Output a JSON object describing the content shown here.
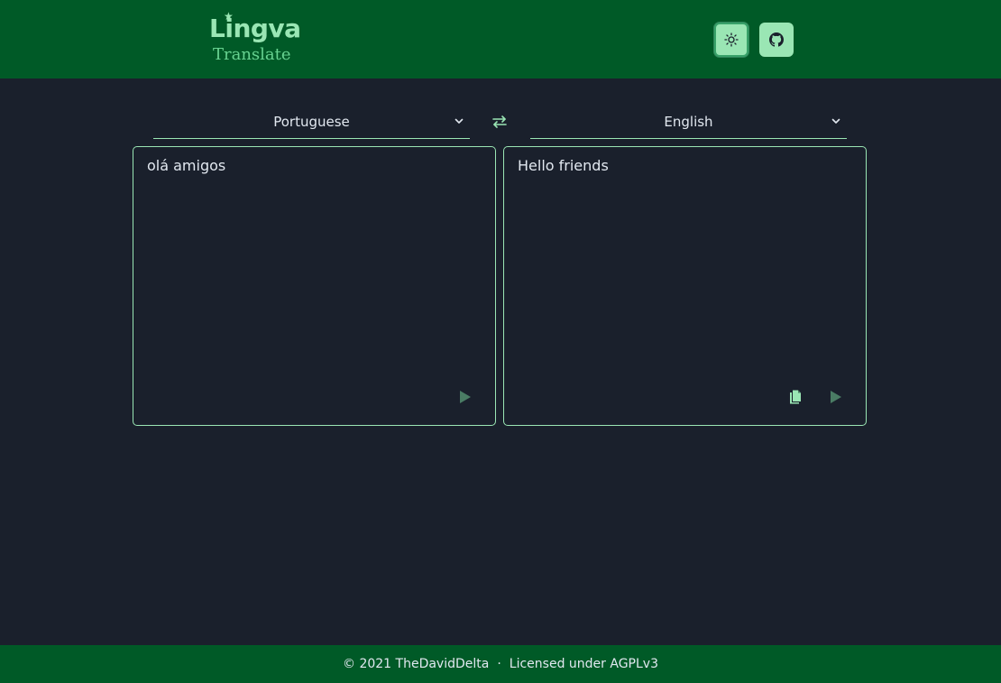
{
  "header": {
    "logo": {
      "main": "Lingva",
      "sub": "Translate"
    },
    "theme_icon": "sun-icon",
    "github_icon": "github-icon"
  },
  "languages": {
    "source": "Portuguese",
    "target": "English",
    "swap_icon": "swap-arrows-icon"
  },
  "source_box": {
    "text": "olá amigos",
    "play_icon": "play-icon"
  },
  "target_box": {
    "text": "Hello friends",
    "copy_icon": "copy-icon",
    "play_icon": "play-icon"
  },
  "footer": {
    "copyright": "© 2021 TheDavidDelta",
    "separator": "·",
    "license": "Licensed under AGPLv3"
  },
  "colors": {
    "header_bg": "#005a27",
    "body_bg": "#1a202c",
    "accent": "#9ae6b4",
    "icon_muted": "#4a7c64"
  }
}
